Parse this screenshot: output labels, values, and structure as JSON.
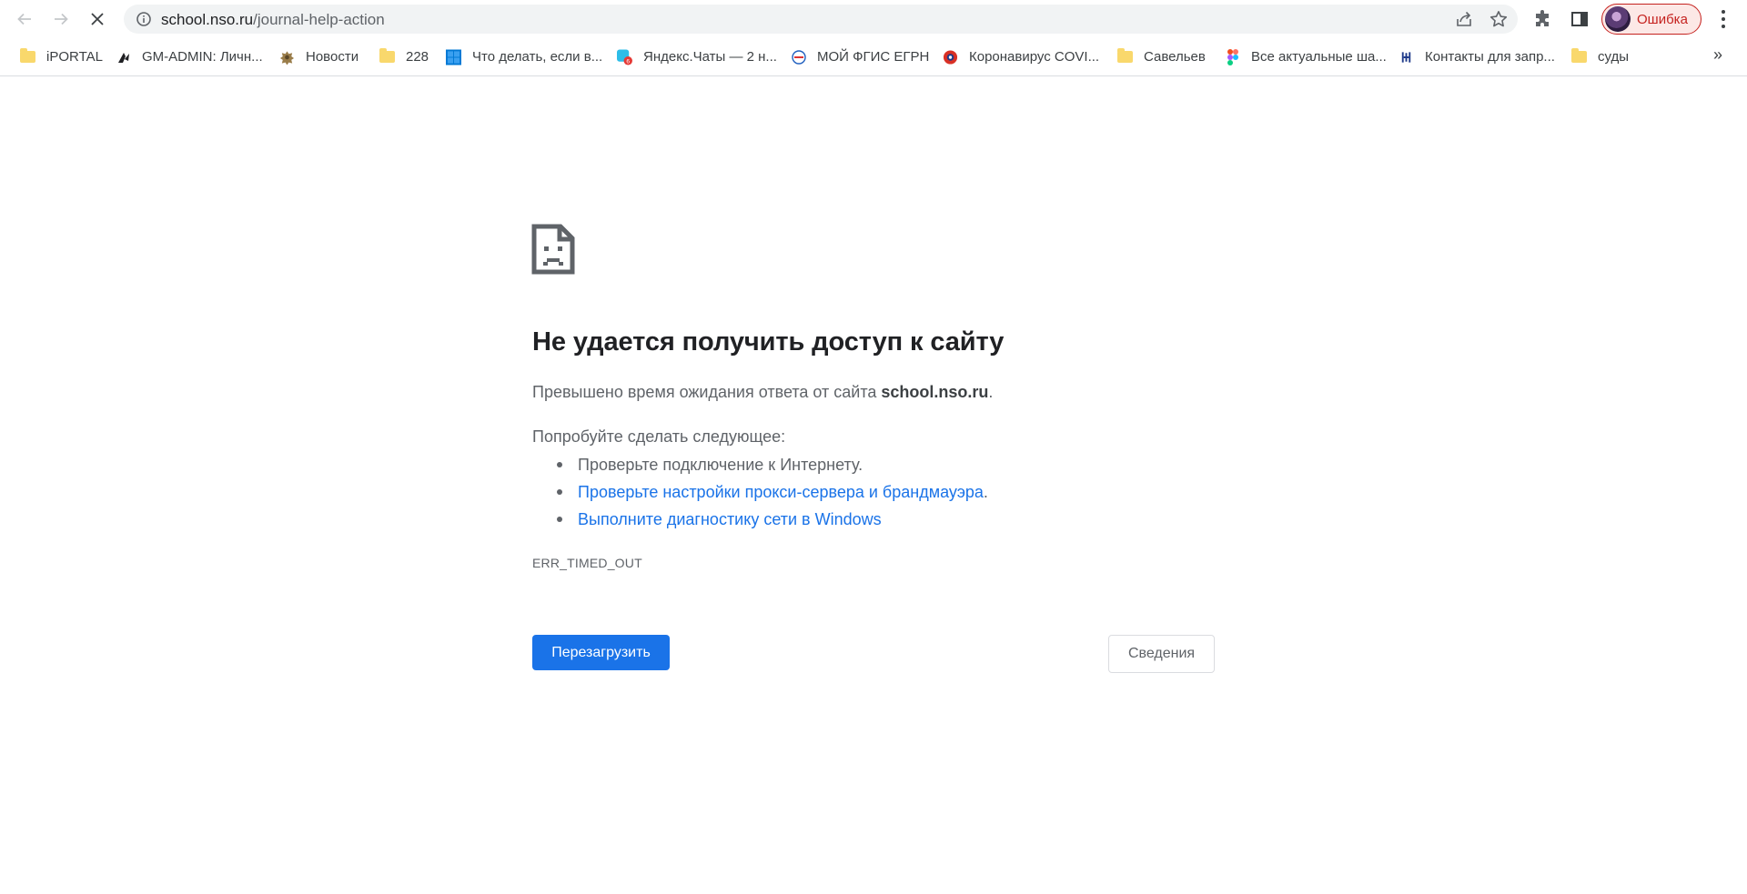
{
  "toolbar": {
    "url_host": "school.nso.ru",
    "url_path": "/journal-help-action",
    "profile_label": "Ошибка"
  },
  "bookmarks": {
    "items": [
      {
        "label": "iPORTAL",
        "icon": "folder-icon"
      },
      {
        "label": "GM-ADMIN: Личн...",
        "icon": "gm-admin-icon"
      },
      {
        "label": "Новости",
        "icon": "emblem-icon"
      },
      {
        "label": "228",
        "icon": "folder-icon"
      },
      {
        "label": "Что делать, если в...",
        "icon": "windows-icon"
      },
      {
        "label": "Яндекс.Чаты — 2 н...",
        "icon": "yandex-chats-icon"
      },
      {
        "label": "МОЙ ФГИС ЕГРН",
        "icon": "egrn-icon"
      },
      {
        "label": "Коронавирус COVI...",
        "icon": "covid-icon"
      },
      {
        "label": "Савельев",
        "icon": "folder-icon"
      },
      {
        "label": "Все актуальные ша...",
        "icon": "figma-icon"
      },
      {
        "label": "Контакты для запр...",
        "icon": "emblem-icon"
      },
      {
        "label": "суды",
        "icon": "folder-icon"
      }
    ],
    "more": "»"
  },
  "error": {
    "title": "Не удается получить доступ к сайту",
    "desc_prefix": "Превышено время ожидания ответа от сайта ",
    "desc_host": "school.nso.ru",
    "desc_suffix": ".",
    "try_label": "Попробуйте сделать следующее:",
    "suggestions": [
      "Проверьте подключение к Интернету.",
      "Проверьте настройки прокси-сервера и брандмауэра",
      "Выполните диагностику сети в Windows"
    ],
    "suggestion_suffix": ".",
    "code": "ERR_TIMED_OUT",
    "reload_label": "Перезагрузить",
    "details_label": "Сведения"
  },
  "colors": {
    "link": "#1a73e8",
    "primary_button": "#1a73e8",
    "profile_error": "#c5221f"
  }
}
